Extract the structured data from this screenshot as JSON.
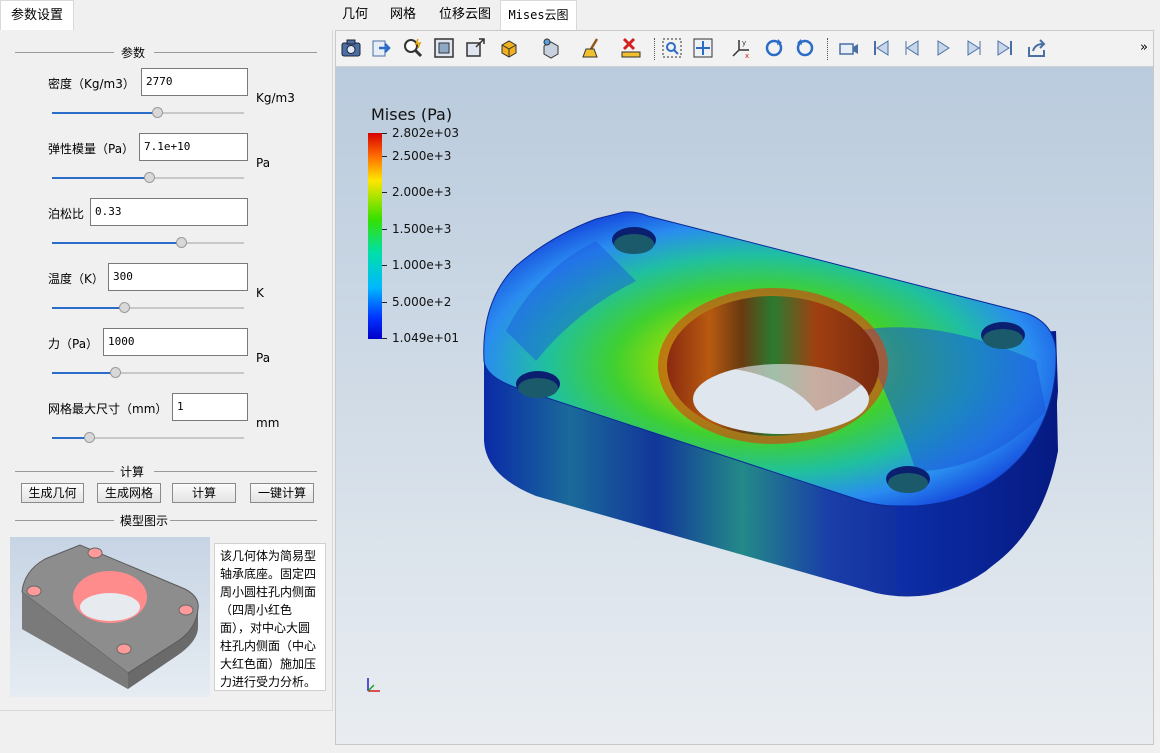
{
  "left_tab": {
    "label": "参数设置"
  },
  "main_tabs": [
    {
      "label": "几何"
    },
    {
      "label": "网格"
    },
    {
      "label": "位移云图"
    },
    {
      "label": "Mises云图"
    }
  ],
  "params": {
    "section_title": "参数",
    "density": {
      "label": "密度（Kg/m3）",
      "value": "2770",
      "unit": "Kg/m3"
    },
    "elastic": {
      "label": "弹性模量（Pa）",
      "value": "7.1e+10",
      "unit": "Pa"
    },
    "poisson": {
      "label": "泊松比",
      "value": "0.33"
    },
    "temperature": {
      "label": "温度（K）",
      "value": "300",
      "unit": "K"
    },
    "force": {
      "label": "力（Pa）",
      "value": "1000",
      "unit": "Pa"
    },
    "mesh": {
      "label": "网格最大尺寸（mm）",
      "value": "1",
      "unit": "mm"
    }
  },
  "compute": {
    "section_title": "计算",
    "gen_geometry": "生成几何",
    "gen_mesh": "生成网格",
    "calculate": "计算",
    "one_click": "一键计算"
  },
  "model": {
    "section_title": "模型图示",
    "description": "该几何体为简易型轴承底座。固定四周小圆柱孔内侧面（四周小红色面），对中心大圆柱孔内侧面（中心大红色面）施加压力进行受力分析。"
  },
  "legend": {
    "title": "Mises (Pa)",
    "labels": [
      "2.802e+03",
      "2.500e+3",
      "2.000e+3",
      "1.500e+3",
      "1.000e+3",
      "5.000e+2",
      "1.049e+01"
    ]
  },
  "toolbar": {
    "more": "»"
  },
  "colors": {
    "accent": "#2a6cc7",
    "selected_tab_border": "#d9d9d9"
  }
}
